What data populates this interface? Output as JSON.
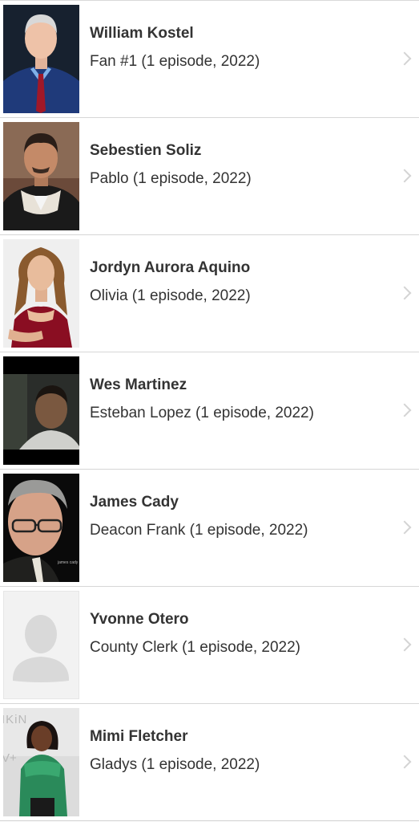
{
  "cast": [
    {
      "name": "William Kostel",
      "role": "Fan #1 (1 episode, 2022)",
      "photo_icon": "headshot-photo"
    },
    {
      "name": "Sebestien Soliz",
      "role": "Pablo (1 episode, 2022)",
      "photo_icon": "headshot-photo"
    },
    {
      "name": "Jordyn Aurora Aquino",
      "role": "Olivia (1 episode, 2022)",
      "photo_icon": "headshot-photo"
    },
    {
      "name": "Wes Martinez",
      "role": "Esteban Lopez (1 episode, 2022)",
      "photo_icon": "headshot-photo"
    },
    {
      "name": "James Cady",
      "role": "Deacon Frank (1 episode, 2022)",
      "photo_icon": "headshot-photo",
      "photo_caption": "james cady"
    },
    {
      "name": "Yvonne Otero",
      "role": "County Clerk (1 episode, 2022)",
      "photo_icon": "placeholder-person-icon"
    },
    {
      "name": "Mimi Fletcher",
      "role": "Gladys (1 episode, 2022)",
      "photo_icon": "headshot-photo",
      "photo_backdrop_text": [
        "IKiN",
        "V+"
      ]
    }
  ],
  "colors": {
    "text": "#333333",
    "divider": "#d6d6d6",
    "chevron": "#d4d4d4",
    "placeholder_bg": "#f2f2f2",
    "placeholder_figure": "#d9d9d9"
  }
}
